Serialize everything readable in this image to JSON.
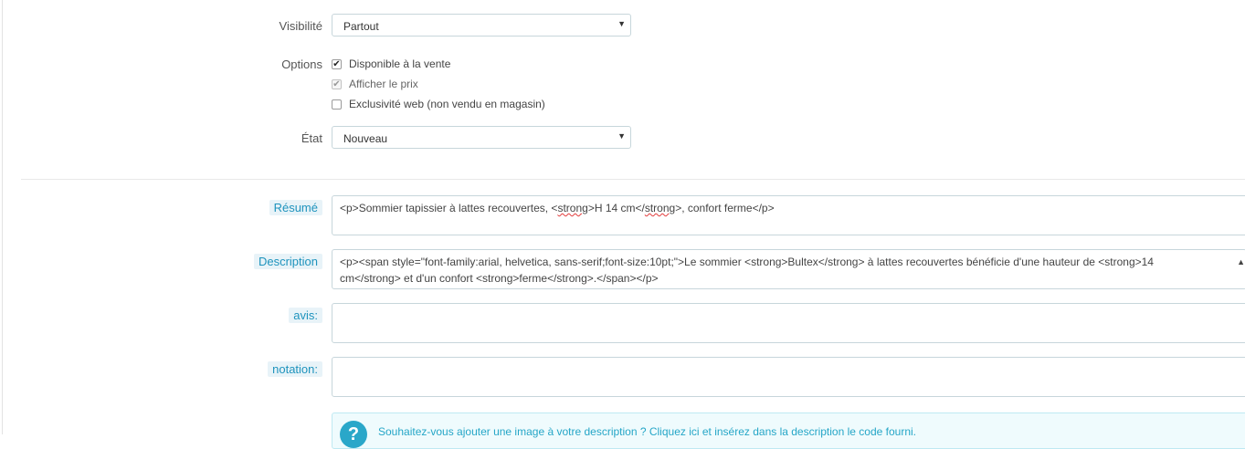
{
  "visibility": {
    "label": "Visibilité",
    "selected": "Partout"
  },
  "options": {
    "label": "Options",
    "items": [
      {
        "label": "Disponible à la vente",
        "checked": true
      },
      {
        "label": "Afficher le prix",
        "checked": true,
        "disabled": true
      },
      {
        "label": "Exclusivité web (non vendu en magasin)",
        "checked": false
      }
    ]
  },
  "condition": {
    "label": "État",
    "selected": "Nouveau"
  },
  "summary": {
    "label": "Résumé",
    "parts": [
      "<p>Sommier tapissier à lattes recouvertes, <",
      "strong",
      ">H 14 cm</",
      "strong",
      ">, confort ferme</p>"
    ]
  },
  "description": {
    "label": "Description",
    "line1": "<p><span style=\"font-family:arial, helvetica, sans-serif;font-size:10pt;\">Le sommier <strong>Bultex</strong> à lattes recouvertes bénéficie d'une hauteur de <strong>14",
    "line2": "cm</strong> et d'un confort <strong>ferme</strong>.</span></p>"
  },
  "avis": {
    "label": "avis:",
    "value": ""
  },
  "notation": {
    "label": "notation:",
    "value": ""
  },
  "info": {
    "text": "Souhaitez-vous ajouter une image à votre description ? Cliquez ici et insérez dans la description le code fourni."
  }
}
